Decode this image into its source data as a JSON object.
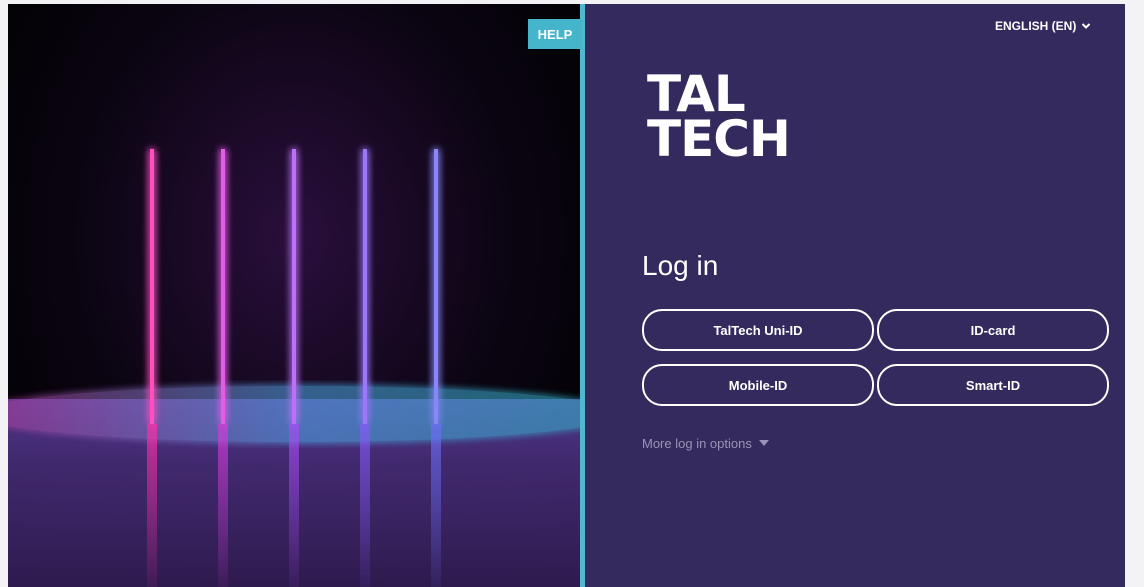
{
  "help": {
    "label": "HELP"
  },
  "language": {
    "label": "ENGLISH (EN)"
  },
  "logo": {
    "line1": "TAL",
    "line2": "TECH"
  },
  "login": {
    "title": "Log in",
    "methods": [
      "TalTech Uni-ID",
      "ID-card",
      "Mobile-ID",
      "Smart-ID"
    ],
    "more_options": "More log in options"
  },
  "colors": {
    "panel_bg": "#342a5d",
    "accent": "#45b5cc",
    "muted_text": "#9a93b7"
  },
  "icons": {
    "language_chevron": "chevron-down-icon",
    "more_options_caret": "caret-down-icon"
  }
}
